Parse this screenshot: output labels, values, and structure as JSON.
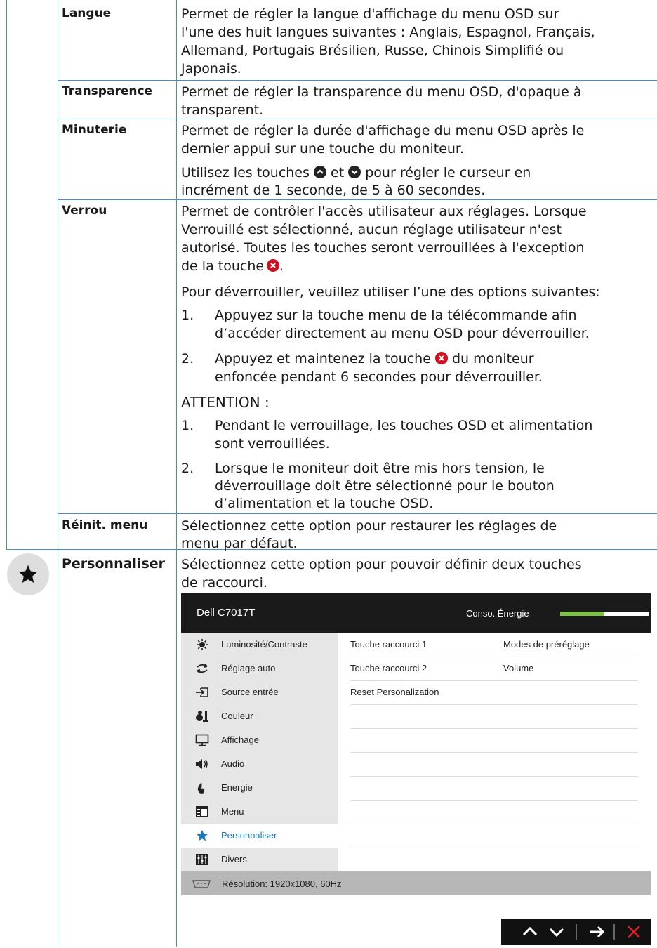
{
  "rows": {
    "langue": {
      "label": "Langue",
      "lines": [
        "Permet de régler la langue d'affichage du menu OSD sur",
        "l'une des huit langues suivantes : Anglais, Espagnol, Français,",
        "Allemand, Portugais Brésilien, Russe, Chinois Simplifié ou",
        "Japonais."
      ]
    },
    "transparence": {
      "label": "Transparence",
      "lines": [
        "Permet de régler la transparence du menu OSD, d'opaque à",
        "transparent."
      ]
    },
    "minuterie": {
      "label": "Minuterie",
      "lines": [
        "Permet de régler la durée d'affichage du menu OSD après le",
        "dernier appui sur une touche du moniteur."
      ],
      "p2_a": "Utilisez les touches",
      "p2_b": "et",
      "p2_c": "pour régler le curseur en",
      "p2_line2": "incrément de 1 seconde, de 5 à 60 secondes."
    },
    "verrou": {
      "label": "Verrou",
      "lines": [
        "Permet de contrôler l'accès utilisateur aux réglages. Lorsque",
        "Verrouillé est sélectionné, aucun réglage utilisateur n'est",
        "autorisé. Toutes les touches seront verrouillées à l'exception"
      ],
      "line4": "de la touche",
      "line4_end": ".",
      "unlock_intro": "Pour déverrouiller, veuillez utiliser l’une des options suivantes:",
      "opt1_num": "1.",
      "opt1": [
        "Appuyez sur la touche menu de la télécommande afin",
        "d’accéder directement au menu OSD pour déverrouiller."
      ],
      "opt2_num": "2.",
      "opt2_a": "Appuyez et maintenez la touche",
      "opt2_b": "du moniteur",
      "opt2_line2": "enfoncée pendant 6 secondes pour déverrouiller.",
      "attention": "ATTENTION :",
      "att1_num": "1.",
      "att1": [
        "Pendant le verrouillage, les touches OSD et alimentation",
        "sont verrouillées."
      ],
      "att2_num": "2.",
      "att2": [
        "Lorsque le moniteur doit être mis hors tension, le",
        "déverrouillage doit être sélectionné pour le bouton",
        "d’alimentation et la touche OSD."
      ]
    },
    "reinit": {
      "label": "Réinit. menu",
      "lines": [
        "Sélectionnez cette option pour restaurer les réglages de",
        "menu par défaut."
      ]
    },
    "personnaliser": {
      "label": "Personnaliser",
      "icon": "star-icon",
      "lines": [
        "Sélectionnez cette option pour pouvoir définir deux touches",
        "de raccourci."
      ]
    }
  },
  "osd": {
    "title": "Dell C7017T",
    "energy_label": "Conso. Énergie",
    "energy_level": 0.5,
    "energy_color": "#7fc442",
    "menu": [
      {
        "label": "Luminosité/Contraste",
        "icon": "brightness-icon"
      },
      {
        "label": "Réglage auto",
        "icon": "auto-adjust-icon"
      },
      {
        "label": "Source entrée",
        "icon": "input-source-icon"
      },
      {
        "label": "Couleur",
        "icon": "color-icon"
      },
      {
        "label": "Affichage",
        "icon": "display-icon"
      },
      {
        "label": "Audio",
        "icon": "speaker-icon"
      },
      {
        "label": "Energie",
        "icon": "energy-icon"
      },
      {
        "label": "Menu",
        "icon": "menu-icon"
      },
      {
        "label": "Personnaliser",
        "icon": "star-icon",
        "selected": true
      },
      {
        "label": "Divers",
        "icon": "sliders-icon"
      }
    ],
    "options": [
      {
        "name": "Touche raccourci 1",
        "value": "Modes de  préréglage"
      },
      {
        "name": "Touche raccourci 2",
        "value": "Volume"
      },
      {
        "name": "Reset Personalization",
        "value": ""
      }
    ],
    "resolution": "Résolution: 1920x1080, 60Hz",
    "accent_color": "#1a7bc4"
  },
  "nav_buttons": [
    "up-icon",
    "down-icon",
    "right-arrow-icon",
    "close-icon"
  ]
}
